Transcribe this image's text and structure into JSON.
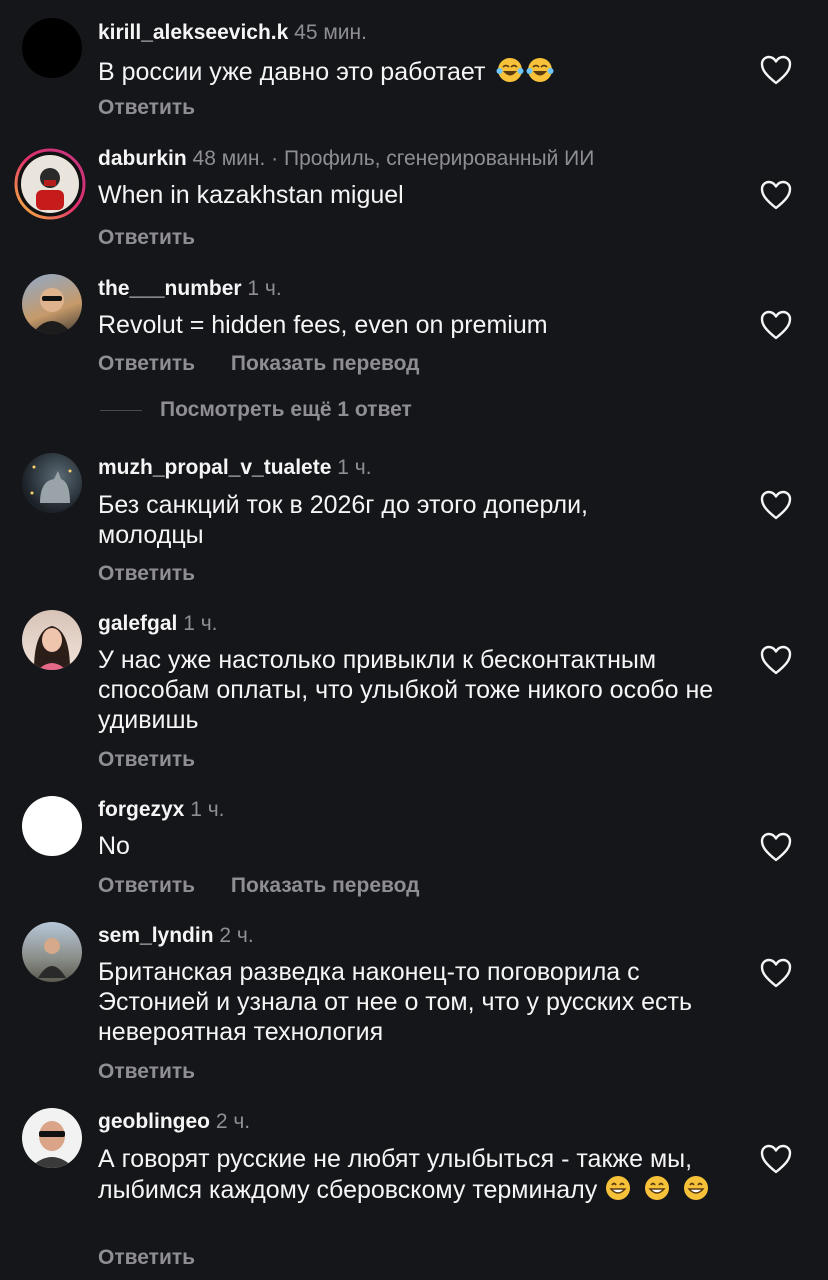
{
  "colors": {
    "background": "#15161a",
    "text": "#f5f5f5",
    "secondary": "#8e8e93"
  },
  "reply_label": "Ответить",
  "translate_label": "Показать перевод",
  "view_more_replies": "Посмотреть ещё 1 ответ",
  "comments": [
    {
      "user": "kirill_alekseevich.k",
      "time": "45 мин.",
      "text": "В россии уже давно это работает",
      "emoji": "joy-emoji x2"
    },
    {
      "user": "daburkin",
      "time": "48 мин. · Профиль, сгенерированный ИИ",
      "text": "When in kazakhstan miguel"
    },
    {
      "user": "the___number",
      "time": "1 ч.",
      "text": "Revolut = hidden fees, even on premium"
    },
    {
      "user": "muzh_propal_v_tualete",
      "time": "1 ч.",
      "text": "Без санкций ток в 2026г до этого доперли, молодцы"
    },
    {
      "user": "galefgal",
      "time": "1 ч.",
      "text": "У нас уже настолько привыкли к бесконтактным способам оплаты, что улыбкой тоже никого особо не удивишь"
    },
    {
      "user": "forgezyx",
      "time": "1 ч.",
      "text": "No"
    },
    {
      "user": "sem_lyndin",
      "time": "2 ч.",
      "text": "Британская разведка наконец-то поговорила с Эстонией и узнала от нее о том, что у русских есть невероятная технология"
    },
    {
      "user": "geoblingeo",
      "time": "2 ч.",
      "text": "А говорят русские не любят улыбыться - также мы, лыбимся каждому сберовскому терминалу",
      "emoji": "grin-emoji x3"
    }
  ]
}
